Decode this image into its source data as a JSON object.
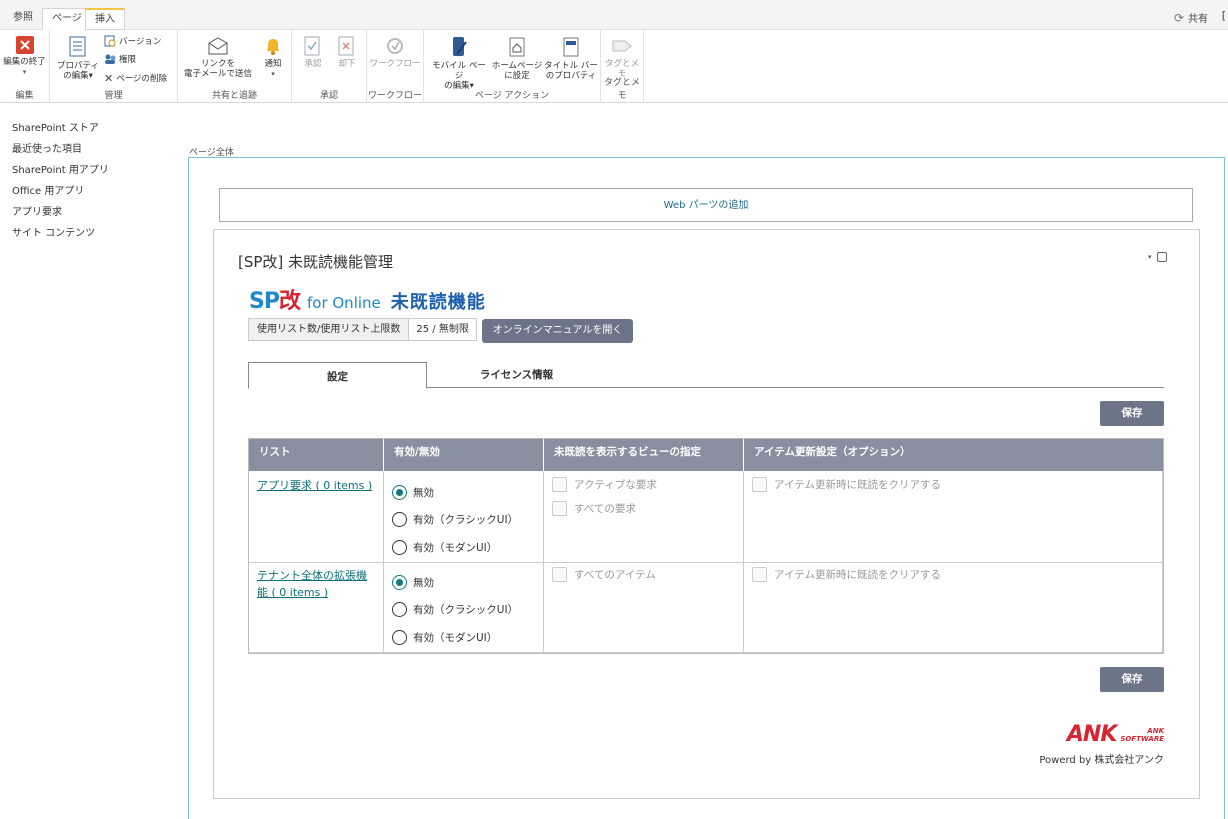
{
  "ribbon_tabs": [
    "参照",
    "ページ",
    "挿入"
  ],
  "share_label": "共有",
  "edge_mark": "[",
  "ribbon": {
    "edit": {
      "finish": "編集の終了",
      "group": "編集"
    },
    "manage": {
      "properties_1": "プロパティ",
      "properties_2": "の編集",
      "version": "バージョン",
      "permissions": "権限",
      "delete": "ページの削除",
      "group": "管理"
    },
    "share": {
      "email_1": "リンクを",
      "email_2": "電子メールで送信",
      "alert": "通知",
      "group": "共有と追跡"
    },
    "approval": {
      "approve": "承認",
      "reject": "却下",
      "group": "承認"
    },
    "workflow": {
      "workflow": "ワークフロー",
      "group": "ワークフロー"
    },
    "actions": {
      "mobile_1": "モバイル ページ",
      "mobile_2": "の編集",
      "home_1": "ホームページ",
      "home_2": "に設定",
      "titlebar_1": "タイトル バー",
      "titlebar_2": "のプロパティ",
      "group": "ページ アクション"
    },
    "tags": {
      "tags": "タグとメモ",
      "group": "タグとメモ"
    }
  },
  "left_nav": [
    "SharePoint ストア",
    "最近使った項目",
    "SharePoint 用アプリ",
    "Office 用アプリ",
    "アプリ要求",
    "サイト コンテンツ"
  ],
  "zone_label": "ページ全体",
  "add_webpart": "Web パーツの追加",
  "webpart": {
    "title": "[SP改] 未既読機能管理",
    "logo": {
      "sp": "SP",
      "kai": "改",
      "for_online": "for Online",
      "feature": "未既読機能"
    },
    "usage_label": "使用リスト数/使用リスト上限数",
    "usage_value": "25 / 無制限",
    "manual_button": "オンラインマニュアルを開く",
    "tab_settings": "設定",
    "tab_license": "ライセンス情報",
    "save": "保存",
    "columns": [
      "リスト",
      "有効/無効",
      "未既読を表示するビューの指定",
      "アイテム更新設定（オプション）"
    ],
    "rows": [
      {
        "link": "アプリ要求 ( 0 items )",
        "options": [
          "無効",
          "有効（クラシックUI）",
          "有効（モダンUI）"
        ],
        "selected": 0,
        "views": [
          "アクティブな要求",
          "すべての要求"
        ],
        "update": "アイテム更新時に既読をクリアする"
      },
      {
        "link_line1": "テナント全体の拡張機",
        "link_line2": "能 ( 0 items )",
        "options": [
          "無効",
          "有効（クラシックUI）",
          "有効（モダンUI）"
        ],
        "selected": 0,
        "views": [
          "すべてのアイテム"
        ],
        "update": "アイテム更新時に既読をクリアする"
      }
    ],
    "footer": {
      "ank": "ANK",
      "software_1": "ANK",
      "software_2": "SOFTWARE",
      "powered": "Powerd by 株式会社アンク"
    }
  }
}
